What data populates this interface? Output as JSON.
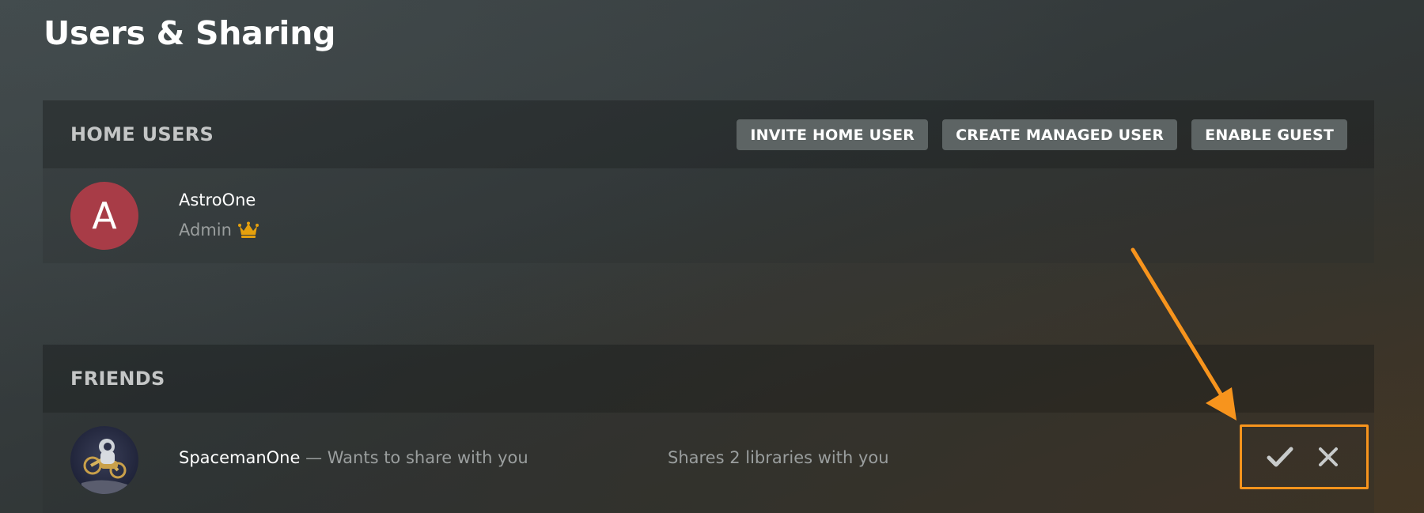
{
  "page": {
    "title": "Users & Sharing"
  },
  "home_users": {
    "title": "HOME USERS",
    "actions": {
      "invite": "INVITE HOME USER",
      "create_managed": "CREATE MANAGED USER",
      "enable_guest": "ENABLE GUEST"
    },
    "users": [
      {
        "initial": "A",
        "name": "AstroOne",
        "role": "Admin",
        "role_icon": "crown-icon"
      }
    ]
  },
  "friends": {
    "title": "FRIENDS",
    "items": [
      {
        "name": "SpacemanOne",
        "separator": " — ",
        "status": "Wants to share with you",
        "libraries": "Shares 2 libraries with you",
        "accept_icon": "checkmark-icon",
        "decline_icon": "close-icon"
      }
    ]
  },
  "colors": {
    "accent_orange": "#f7941d",
    "avatar_red": "#a83c47",
    "crown_gold": "#e5a00d",
    "button_bg": "#5d6464"
  }
}
